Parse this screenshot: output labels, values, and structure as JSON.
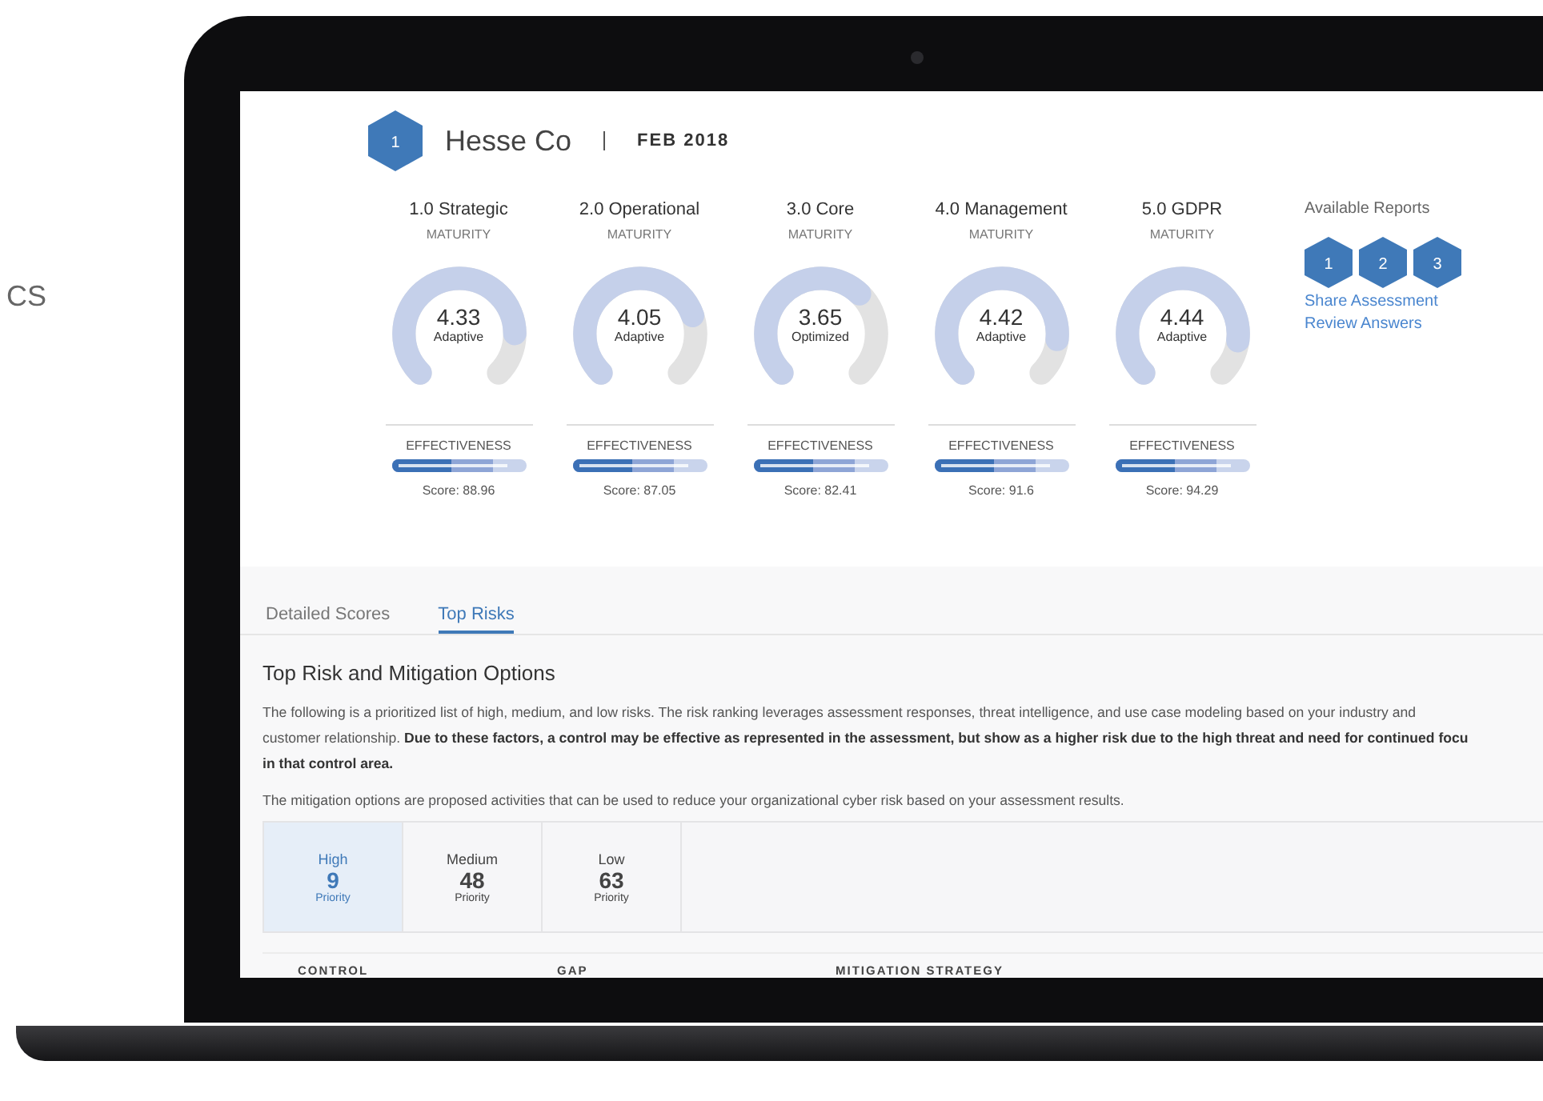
{
  "side_text": "CS",
  "header": {
    "badge": "1",
    "company": "Hesse Co",
    "date": "FEB 2018"
  },
  "categories": [
    {
      "title": "1.0 Strategic",
      "subtitle": "MATURITY",
      "value": "4.33",
      "rating": "Adaptive",
      "effectiveness": {
        "label": "EFFECTIVENESS",
        "level": 0.45,
        "score": "Score: 88.96"
      }
    },
    {
      "title": "2.0 Operational",
      "subtitle": "MATURITY",
      "value": "4.05",
      "rating": "Adaptive",
      "effectiveness": {
        "label": "EFFECTIVENESS",
        "level": 0.45,
        "score": "Score: 87.05"
      }
    },
    {
      "title": "3.0 Core",
      "subtitle": "MATURITY",
      "value": "3.65",
      "rating": "Optimized",
      "effectiveness": {
        "label": "EFFECTIVENESS",
        "level": 0.45,
        "score": "Score: 82.41"
      }
    },
    {
      "title": "4.0 Management",
      "subtitle": "MATURITY",
      "value": "4.42",
      "rating": "Adaptive",
      "effectiveness": {
        "label": "EFFECTIVENESS",
        "level": 0.45,
        "score": "Score: 91.6"
      }
    },
    {
      "title": "5.0 GDPR",
      "subtitle": "MATURITY",
      "value": "4.44",
      "rating": "Adaptive",
      "effectiveness": {
        "label": "EFFECTIVENESS",
        "level": 0.45,
        "score": "Score: 94.29"
      }
    }
  ],
  "reports": {
    "title": "Available Reports",
    "badges": [
      "1",
      "2",
      "3"
    ],
    "links": [
      "Share Assessment",
      "Review Answers"
    ]
  },
  "tabs": [
    {
      "label": "Detailed Scores",
      "selected": false
    },
    {
      "label": "Top Risks",
      "selected": true
    }
  ],
  "section_title": "Top Risk and Mitigation Options",
  "intro_lines": [
    "The following is a prioritized list of high, medium, and low risks. The risk ranking leverages assessment responses, threat intelligence, and use case modeling based on your industry and",
    "customer relationship. **Due to these factors, a control may be effective as represented in the assessment, but show as a higher risk due to the high threat and need for continued focu**",
    "**in that control area.**"
  ],
  "mitigation_text": "The mitigation options are proposed activities that can be used to reduce your organizational cyber risk based on your assessment results.",
  "priorities": [
    {
      "label": "High",
      "count": "9",
      "unit": "Priority",
      "selected": true
    },
    {
      "label": "Medium",
      "count": "48",
      "unit": "Priority",
      "selected": false
    },
    {
      "label": "Low",
      "count": "63",
      "unit": "Priority",
      "selected": false
    }
  ],
  "table": {
    "columns": [
      "CONTROL",
      "GAP",
      "MITIGATION STRATEGY"
    ]
  }
}
